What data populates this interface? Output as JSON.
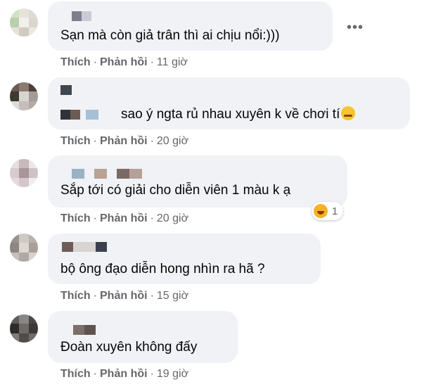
{
  "comments": [
    {
      "text": "Sạn mà còn giả trân thì ai chịu nổi:)))",
      "like": "Thích",
      "reply": "Phản hồi",
      "time": "11 giờ",
      "more": "•••"
    },
    {
      "text": "sao ý ngta rủ nhau xuyên k về chơi tí",
      "like": "Thích",
      "reply": "Phản hồi",
      "time": "20 giờ",
      "inline_emoji": "crying-laughing-face-icon"
    },
    {
      "text": "Sắp tới có giải cho diễn viên 1 màu k ạ",
      "like": "Thích",
      "reply": "Phản hồi",
      "time": "20 giờ",
      "reaction_count": "1",
      "reaction_icon": "haha-reaction-icon"
    },
    {
      "text": "bộ ông đạo diễn hong nhìn ra hã ?",
      "like": "Thích",
      "reply": "Phản hồi",
      "time": "15 giờ"
    },
    {
      "text": "Đoàn xuyên không đấy",
      "like": "Thích",
      "reply": "Phản hồi",
      "time": "19 giờ"
    }
  ],
  "separator": "·",
  "colors": {
    "bubble": "#f0f2f5",
    "meta_text": "#65676b",
    "body_text": "#050505"
  }
}
